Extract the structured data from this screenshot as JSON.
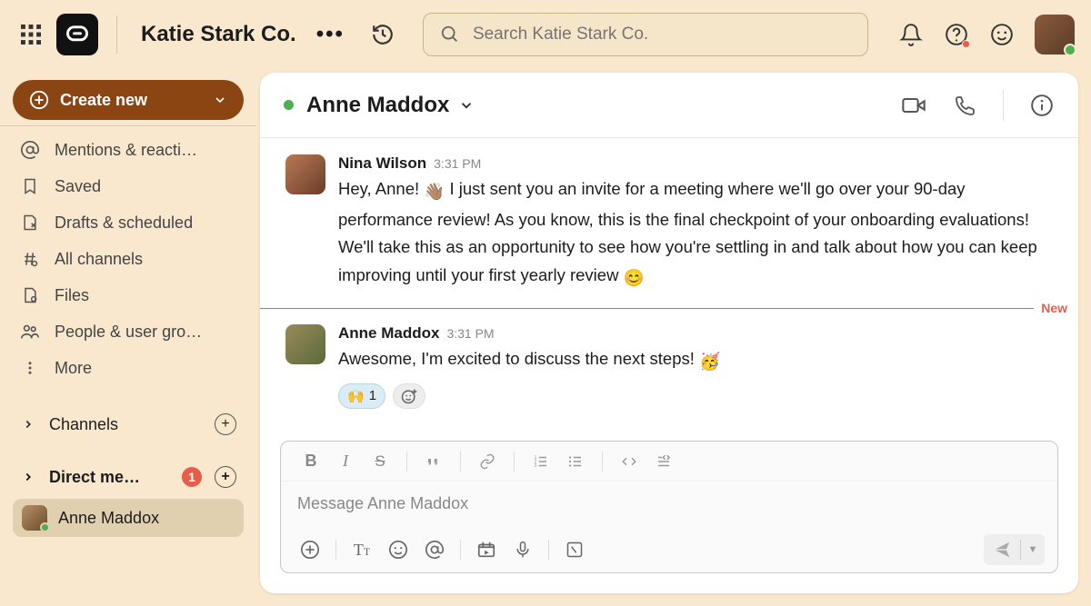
{
  "topbar": {
    "workspace_name": "Katie Stark Co.",
    "search_placeholder": "Search Katie Stark Co."
  },
  "sidebar": {
    "create_label": "Create new",
    "items": [
      {
        "label": "Mentions & reacti…"
      },
      {
        "label": "Saved"
      },
      {
        "label": "Drafts & scheduled"
      },
      {
        "label": "All channels"
      },
      {
        "label": "Files"
      },
      {
        "label": "People & user gro…"
      },
      {
        "label": "More"
      }
    ],
    "channels_label": "Channels",
    "dms_label": "Direct me…",
    "dm_badge": "1",
    "dm_items": [
      {
        "name": "Anne Maddox"
      }
    ]
  },
  "conversation": {
    "title": "Anne Maddox",
    "divider_label": "New",
    "messages": [
      {
        "author": "Nina Wilson",
        "time": "3:31 PM",
        "text_pre": "Hey, Anne! ",
        "wave": "👋🏽",
        "text_post": " I just sent you an invite for a meeting where we'll go over your 90-day performance review! As you know, this is the final checkpoint of your onboarding evaluations! We'll take this as an opportunity to see how you're settling in and talk about how you can keep improving until your first yearly review ",
        "smile": "😊"
      },
      {
        "author": "Anne Maddox",
        "time": "3:31 PM",
        "text_pre": "Awesome, I'm excited to discuss the next steps! ",
        "party": "🥳",
        "reaction_emoji": "🙌",
        "reaction_count": "1"
      }
    ]
  },
  "composer": {
    "placeholder": "Message Anne Maddox"
  }
}
